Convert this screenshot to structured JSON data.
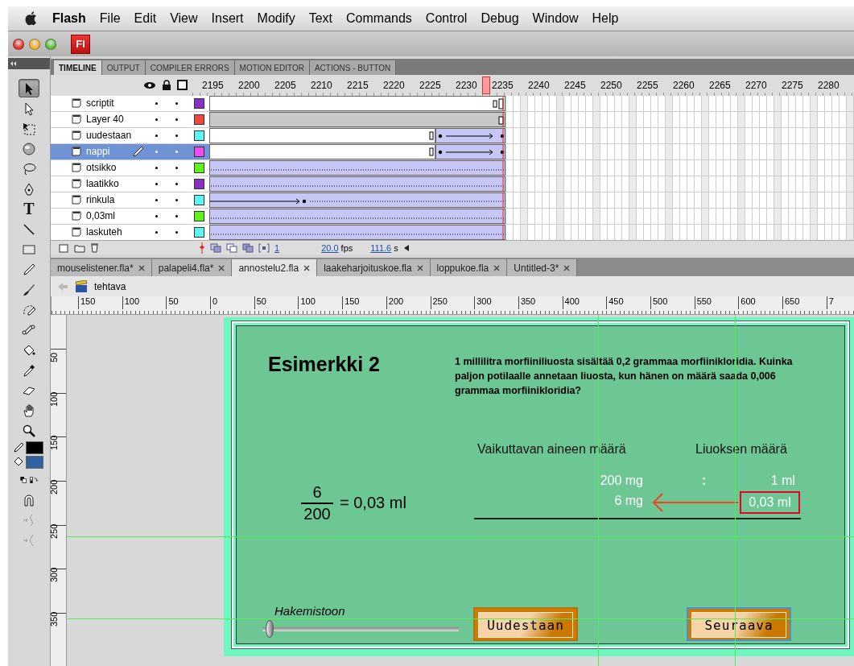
{
  "menu_bar": {
    "app": "Flash",
    "items": [
      "File",
      "Edit",
      "View",
      "Insert",
      "Modify",
      "Text",
      "Commands",
      "Control",
      "Debug",
      "Window",
      "Help"
    ]
  },
  "app_badge": "Fl",
  "panel_tabs": [
    {
      "label": "TIMELINE",
      "selected": true
    },
    {
      "label": "OUTPUT",
      "selected": false
    },
    {
      "label": "COMPILER ERRORS",
      "selected": false
    },
    {
      "label": "MOTION EDITOR",
      "selected": false
    },
    {
      "label": "ACTIONS - BUTTON",
      "selected": false
    }
  ],
  "timeline": {
    "frame_numbers": [
      "2195",
      "2200",
      "2205",
      "2210",
      "2215",
      "2220",
      "2225",
      "2230",
      "2235",
      "2240",
      "2245",
      "2250",
      "2255",
      "2260",
      "2265",
      "2270",
      "2275",
      "2280"
    ],
    "layers": [
      {
        "name": "scriptit",
        "color": "#8b2fc9",
        "selected": false,
        "kind": "blank"
      },
      {
        "name": "Layer 40",
        "color": "#f0483c",
        "selected": false,
        "kind": "static"
      },
      {
        "name": "uudestaan",
        "color": "#5ef5f5",
        "selected": false,
        "kind": "late-tween"
      },
      {
        "name": "nappi",
        "color": "#f04cf0",
        "selected": true,
        "kind": "late-tween"
      },
      {
        "name": "otsikko",
        "color": "#5ff51a",
        "selected": false,
        "kind": "held"
      },
      {
        "name": "laatikko",
        "color": "#8b2fc9",
        "selected": false,
        "kind": "held"
      },
      {
        "name": "rinkula",
        "color": "#5ef5f5",
        "selected": false,
        "kind": "early-tween"
      },
      {
        "name": "0,03ml",
        "color": "#5ff51a",
        "selected": false,
        "kind": "held"
      },
      {
        "name": "laskuteh",
        "color": "#5ef5f5",
        "selected": false,
        "kind": "held"
      }
    ],
    "footer": {
      "frame": "1",
      "fps": "20.0",
      "fps_unit": "fps",
      "time": "111.6",
      "time_unit": "s"
    }
  },
  "tools": [
    {
      "kind": "arrow",
      "selected": true
    },
    {
      "kind": "subselect",
      "selected": false
    },
    {
      "kind": "transform",
      "selected": false
    },
    {
      "kind": "sphere",
      "selected": false
    },
    {
      "kind": "lasso",
      "selected": false
    },
    {
      "kind": "pen",
      "selected": false
    },
    {
      "kind": "text",
      "glyph": "T",
      "selected": false
    },
    {
      "kind": "line",
      "selected": false
    },
    {
      "kind": "rectangle",
      "selected": false
    },
    {
      "kind": "pencil",
      "selected": false
    },
    {
      "kind": "brush",
      "selected": false
    },
    {
      "kind": "deco",
      "selected": false
    },
    {
      "kind": "bone",
      "selected": false
    },
    {
      "kind": "bucket",
      "selected": false
    },
    {
      "kind": "eyedropper",
      "selected": false
    },
    {
      "kind": "eraser",
      "selected": false
    },
    {
      "kind": "hand",
      "selected": false
    },
    {
      "kind": "zoom",
      "selected": false
    },
    {
      "kind": "stroke",
      "color": "#000000"
    },
    {
      "kind": "fill",
      "color": "#2f62a0"
    },
    {
      "kind": "swap",
      "selected": false
    },
    {
      "kind": "magnet",
      "selected": false
    },
    {
      "kind": "smooth",
      "selected": false
    },
    {
      "kind": "straighten",
      "selected": false
    }
  ],
  "document_tabs": [
    {
      "label": "mouselistener.fla*",
      "selected": false
    },
    {
      "label": "palapeli4.fla*",
      "selected": false
    },
    {
      "label": "annostelu2.fla",
      "selected": true
    },
    {
      "label": "laakeharjoituskoe.fla",
      "selected": false
    },
    {
      "label": "loppukoe.fla",
      "selected": false
    },
    {
      "label": "Untitled-3*",
      "selected": false
    }
  ],
  "breadcrumb": "tehtava",
  "rulers": {
    "horizontal": [
      "150",
      "100",
      "50",
      "0",
      "50",
      "100",
      "150",
      "200",
      "250",
      "300",
      "350",
      "400",
      "450",
      "500",
      "550",
      "600",
      "650",
      "7"
    ],
    "vertical": [
      "50",
      "100",
      "150",
      "200",
      "250",
      "300",
      "350"
    ]
  },
  "stage": {
    "title": "Esimerkki 2",
    "question": "1 millilitra morfiiniliuosta sisältää 0,2 grammaa morfiinikloridia. Kuinka paljon potilaalle annetaan liuosta, kun hänen on määrä saada 0,006 grammaa morfiinikloridia?",
    "column_headers": [
      "Vaikuttavan aineen määrä",
      "Liuoksen määrä"
    ],
    "proportion": {
      "top_left": "200 mg",
      "separator": ":",
      "top_right": "1 ml",
      "bottom_left": "6 mg",
      "answer": "0,03 ml"
    },
    "fraction": {
      "numerator": "6",
      "denominator": "200",
      "result": "= 0,03 ml"
    },
    "slider": {
      "label": "Hakemistoon",
      "level": 0
    },
    "buttons": [
      "Uudestaan",
      "Seuraava"
    ]
  }
}
